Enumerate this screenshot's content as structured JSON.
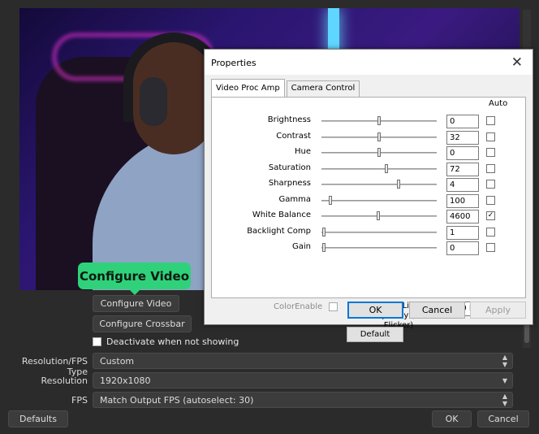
{
  "tooltip": {
    "text": "Configure Video"
  },
  "obs": {
    "configure_video": "Configure Video",
    "configure_crossbar": "Configure Crossbar",
    "deactivate_label": "Deactivate when not showing",
    "resolution_fps_type_label": "Resolution/FPS Type",
    "resolution_fps_type_value": "Custom",
    "resolution_label": "Resolution",
    "resolution_value": "1920x1080",
    "fps_label": "FPS",
    "fps_value": "Match Output FPS (autoselect: 30)",
    "defaults": "Defaults",
    "ok": "OK",
    "cancel": "Cancel"
  },
  "dialog": {
    "title": "Properties",
    "close_icon": "close-icon",
    "tabs": [
      {
        "label": "Video Proc Amp"
      },
      {
        "label": "Camera Control"
      }
    ],
    "auto_header": "Auto",
    "rows": [
      {
        "label": "Brightness",
        "value": "0",
        "slider": 0.5,
        "auto": false
      },
      {
        "label": "Contrast",
        "value": "32",
        "slider": 0.5,
        "auto": false
      },
      {
        "label": "Hue",
        "value": "0",
        "slider": 0.5,
        "auto": false
      },
      {
        "label": "Saturation",
        "value": "72",
        "slider": 0.56,
        "auto": false
      },
      {
        "label": "Sharpness",
        "value": "4",
        "slider": 0.67,
        "auto": false
      },
      {
        "label": "Gamma",
        "value": "100",
        "slider": 0.08,
        "auto": false
      },
      {
        "label": "White Balance",
        "value": "4600",
        "slider": 0.49,
        "auto": true
      },
      {
        "label": "Backlight Comp",
        "value": "1",
        "slider": 0.02,
        "auto": false
      },
      {
        "label": "Gain",
        "value": "0",
        "slider": 0.02,
        "auto": false
      }
    ],
    "color_enable": "ColorEnable",
    "powerline_label": "PowerLine Frequency (Anti Flicker)",
    "powerline_value": "60 Hz",
    "default_btn": "Default",
    "ok": "OK",
    "cancel": "Cancel",
    "apply": "Apply"
  }
}
